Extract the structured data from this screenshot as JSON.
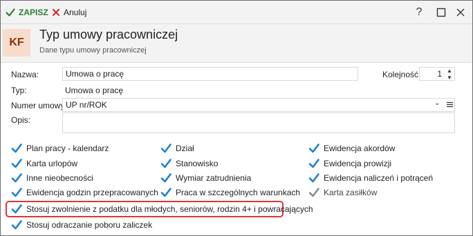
{
  "toolbar": {
    "save_label": "ZAPISZ",
    "cancel_label": "Anuluj",
    "help_glyph": "?",
    "accent_save": "#2e7d32",
    "accent_cancel": "#d32f2f"
  },
  "header": {
    "badge": "KF",
    "title": "Typ umowy pracowniczej",
    "subtitle": "Dane typu umowy pracowniczej"
  },
  "form": {
    "name_label": "Nazwa:",
    "name_value": "Umowa o pracę",
    "order_label": "Kolejność:",
    "order_value": "1",
    "type_label": "Typ:",
    "type_value": "Umowa o pracę",
    "number_label": "Numer umowy:",
    "number_value": "UP nr/ROK",
    "desc_label": "Opis:",
    "desc_value": ""
  },
  "checkboxes": {
    "col1": [
      {
        "label": "Plan pracy - kalendarz",
        "checked": true
      },
      {
        "label": "Karta urlopów",
        "checked": true
      },
      {
        "label": "Inne nieobecności",
        "checked": true
      },
      {
        "label": "Ewidencja godzin przepracowanych",
        "checked": true
      }
    ],
    "col2": [
      {
        "label": "Dział",
        "checked": true
      },
      {
        "label": "Stanowisko",
        "checked": true
      },
      {
        "label": "Wymiar zatrudnienia",
        "checked": true
      },
      {
        "label": "Praca w szczególnych warunkach",
        "checked": true
      }
    ],
    "col3": [
      {
        "label": "Ewidencja akordów",
        "checked": true
      },
      {
        "label": "Ewidencja prowizji",
        "checked": true
      },
      {
        "label": "Ewidencja naliczeń i potrąceń",
        "checked": true
      },
      {
        "label": "Karta zasiłków",
        "checked": true,
        "disabled": true
      }
    ],
    "exemption_label": "Stosuj zwolnienie z podatku dla młodych, seniorów, rodzin 4+ i powracających",
    "deferral_label": "Stosuj odraczanie poboru zaliczek",
    "check_color": "#1a7fd4",
    "disabled_check_color": "#8a8a8a",
    "highlight_color": "#e03434"
  }
}
